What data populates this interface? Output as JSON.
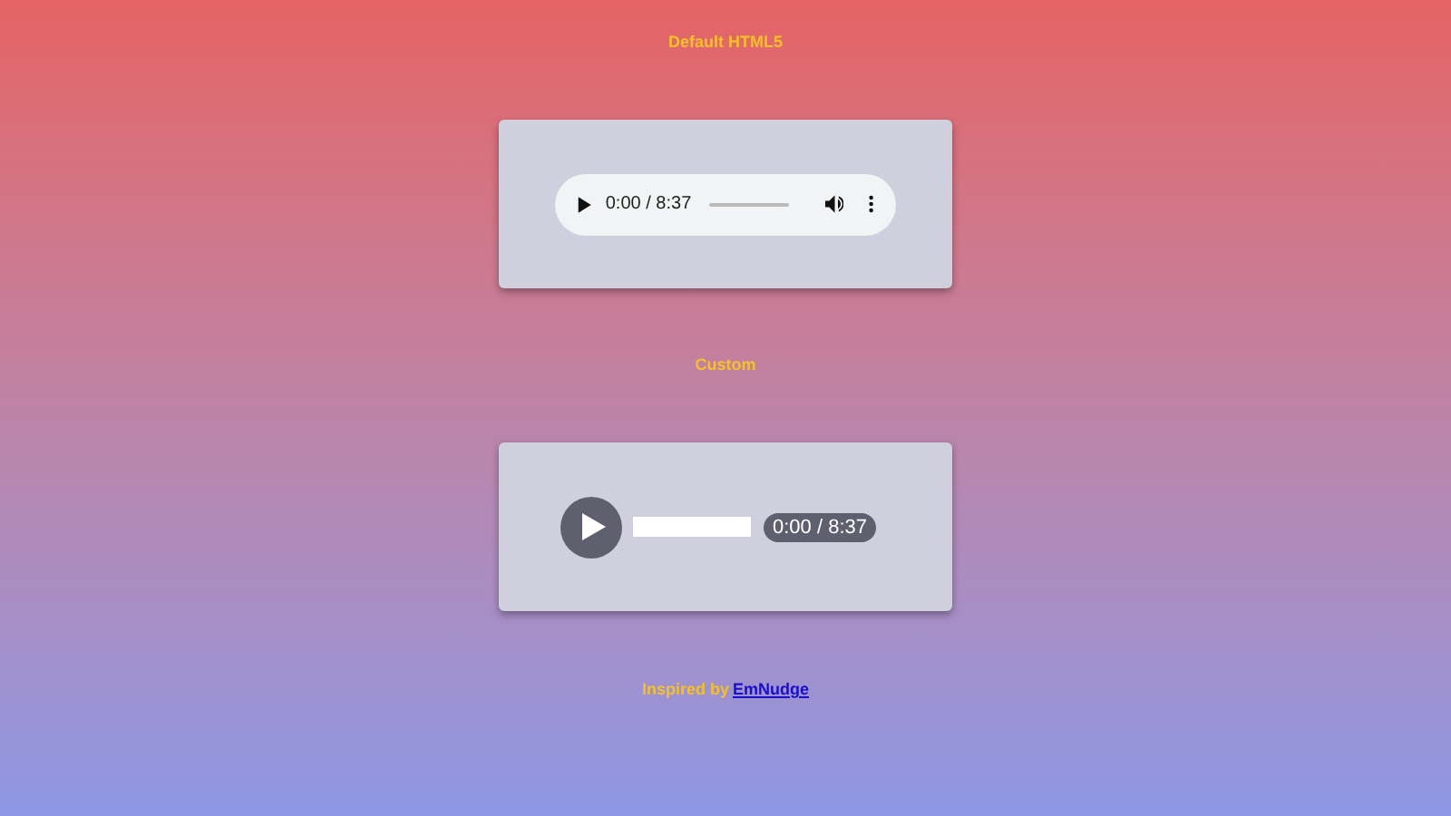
{
  "sections": [
    {
      "heading": "Default HTML5",
      "player": {
        "kind": "native",
        "time": "0:00 / 8:37",
        "level": 0
      }
    },
    {
      "heading": "Custom",
      "player": {
        "kind": "custom",
        "time": "0:00 / 8:37",
        "level": 0
      }
    }
  ],
  "credit": {
    "text": "Inspired by",
    "link": "EmNudge"
  }
}
